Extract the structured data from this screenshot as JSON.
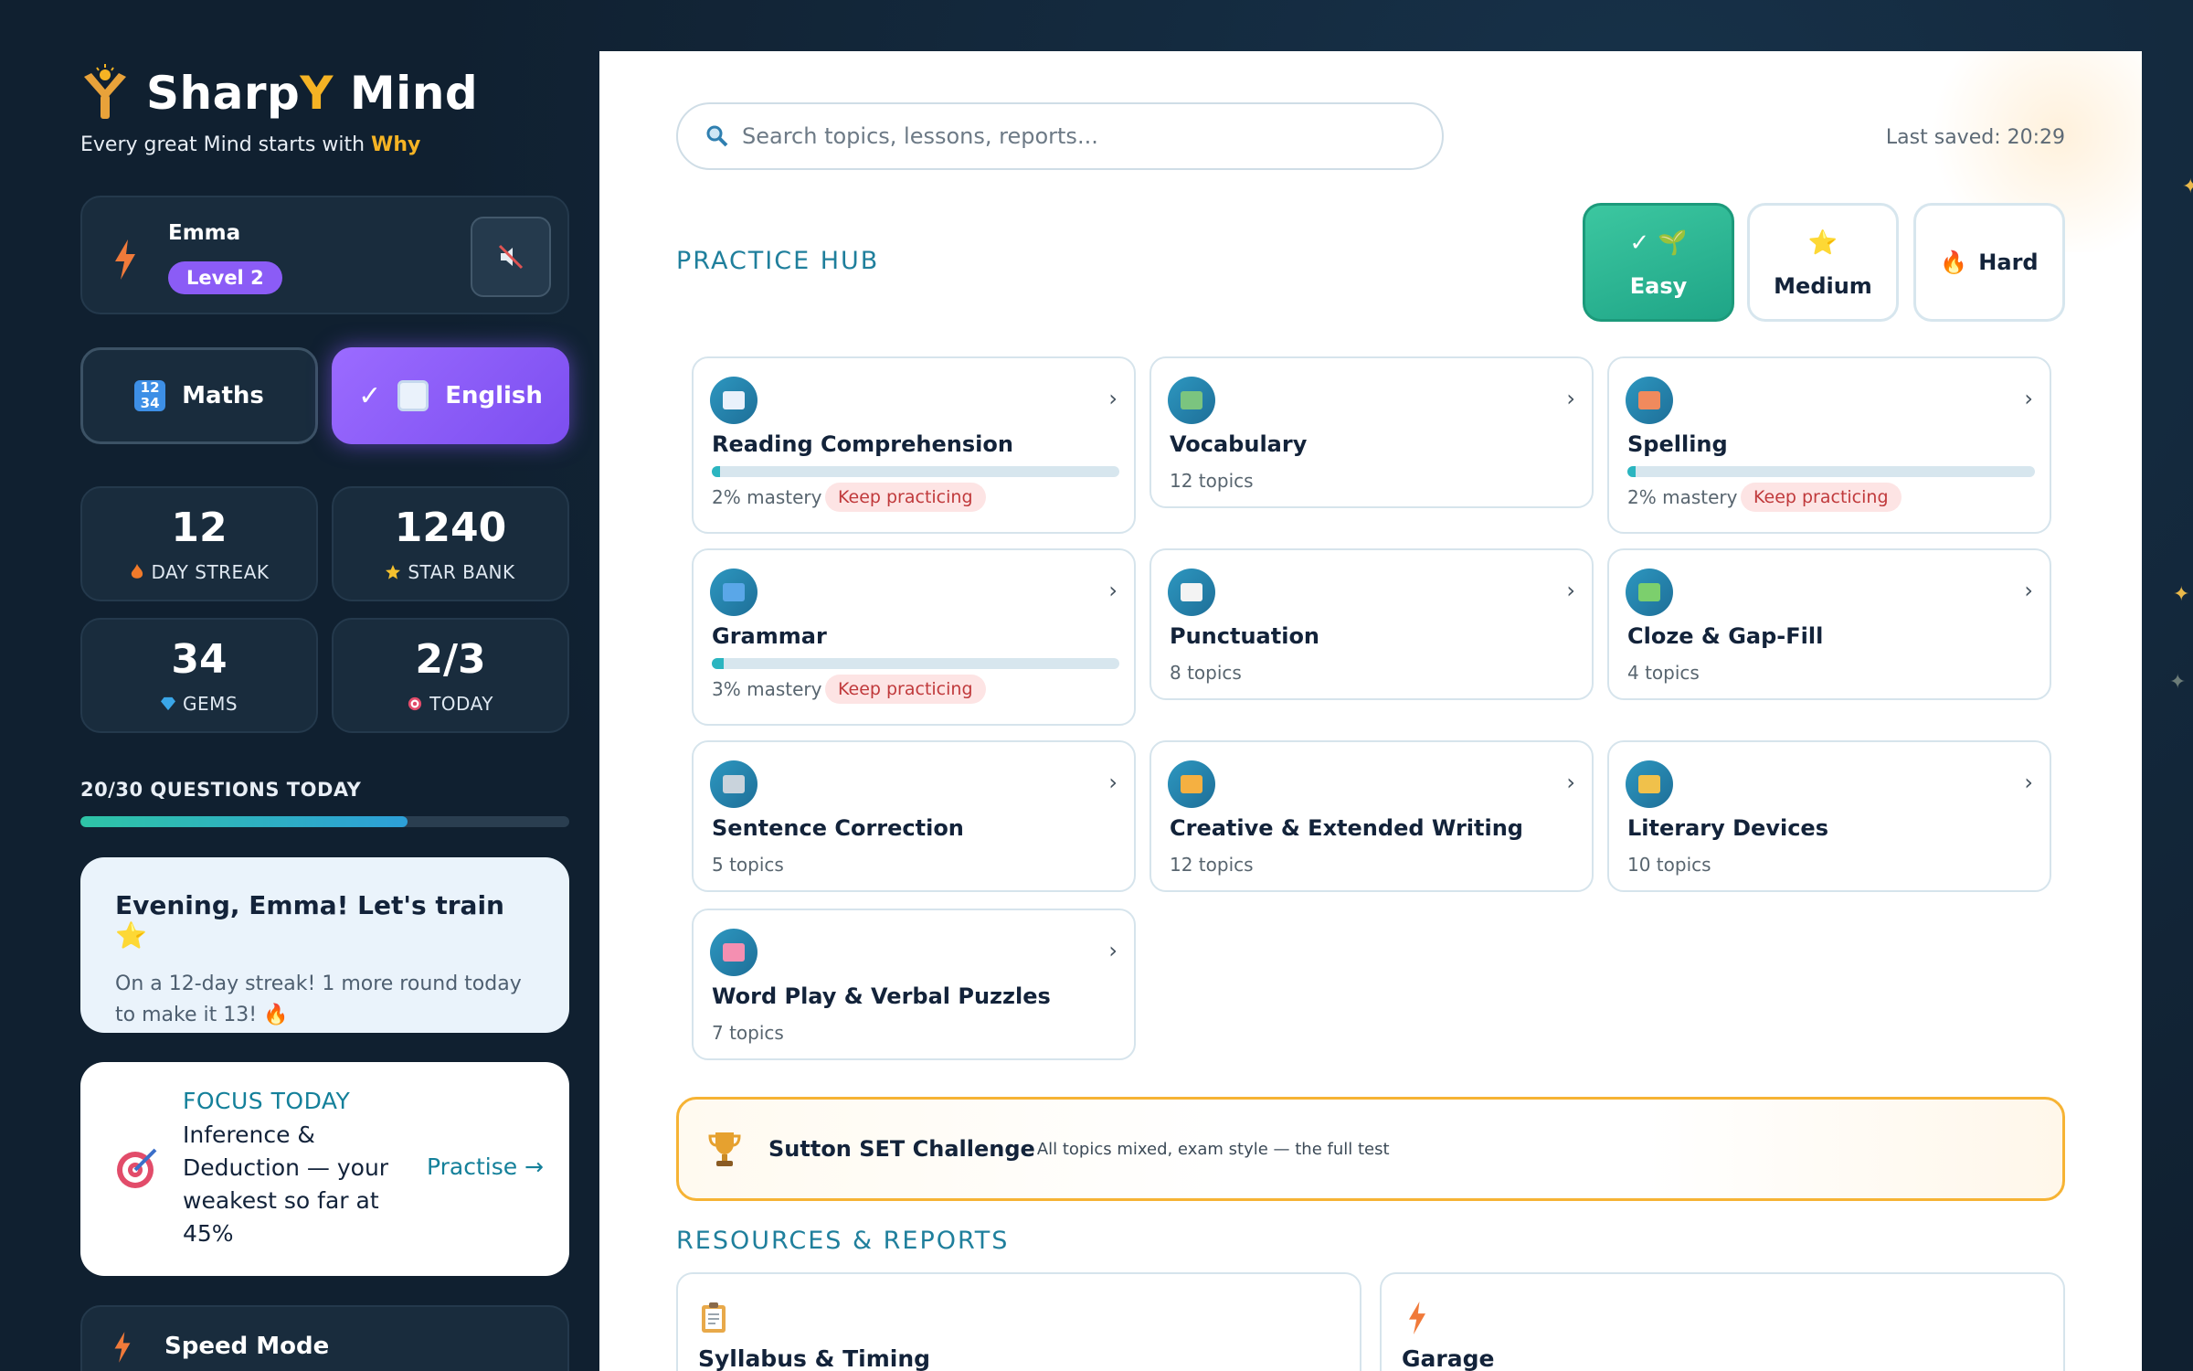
{
  "brand": {
    "name_a": "Sharp",
    "name_y": "Y",
    "name_b": " Mind",
    "tagline": "Every great Mind starts with ",
    "tagline_why": "Why"
  },
  "user": {
    "name": "Emma",
    "level": "Level 2"
  },
  "subjects": [
    {
      "label": "Maths",
      "selected": false
    },
    {
      "label": "English",
      "selected": true,
      "check": "✓"
    }
  ],
  "stats": [
    {
      "value": "12",
      "label": "DAY STREAK",
      "icon": "fire-icon"
    },
    {
      "value": "1240",
      "label": "STAR BANK",
      "icon": "star-icon"
    },
    {
      "value": "34",
      "label": "GEMS",
      "icon": "gem-icon"
    },
    {
      "value": "2/3",
      "label": "TODAY",
      "icon": "target-icon"
    }
  ],
  "questions": {
    "label": "20/30 QUESTIONS TODAY",
    "progress": 0.67
  },
  "greeting": {
    "title": "Evening, Emma! Let's train ⭐",
    "text": "On a 12-day streak! 1 more round today to make it 13! 🔥"
  },
  "focus": {
    "title": "FOCUS TODAY",
    "desc": "Inference & Deduction — your weakest so far at 45%",
    "action": "Practise →"
  },
  "speed": {
    "label": "Speed Mode"
  },
  "search": {
    "placeholder": "Search topics, lessons, reports..."
  },
  "last_saved": "Last saved: 20:29",
  "hub": {
    "title": "PRACTICE HUB",
    "difficulty": [
      {
        "label": "Easy",
        "emoji": "✓ 🌱",
        "selected": true
      },
      {
        "label": "Medium",
        "emoji": "⭐",
        "selected": false
      },
      {
        "label": "Hard",
        "emoji": "🔥",
        "selected": false
      }
    ],
    "topics": [
      {
        "name": "Reading Comprehension",
        "mastery": "2% mastery",
        "status": "Keep practicing",
        "progress": 0.02,
        "icon": "book-icon",
        "color": "#e9f1fb"
      },
      {
        "name": "Vocabulary",
        "count": "12 topics",
        "icon": "books-icon",
        "color": "#7bc47f"
      },
      {
        "name": "Spelling",
        "mastery": "2% mastery",
        "status": "Keep practicing",
        "progress": 0.02,
        "icon": "pencil-icon",
        "color": "#f08a5d"
      },
      {
        "name": "Grammar",
        "mastery": "3% mastery",
        "status": "Keep practicing",
        "progress": 0.03,
        "icon": "abc-icon",
        "color": "#5aa7e8"
      },
      {
        "name": "Punctuation",
        "count": "8 topics",
        "icon": "memo-icon",
        "color": "#f3f3f3"
      },
      {
        "name": "Cloze & Gap-Fill",
        "count": "4 topics",
        "icon": "puzzle-icon",
        "color": "#7ccf6d"
      },
      {
        "name": "Sentence Correction",
        "count": "5 topics",
        "icon": "wrench-icon",
        "color": "#c9d3dc"
      },
      {
        "name": "Creative & Extended Writing",
        "count": "12 topics",
        "icon": "writing-hand-icon",
        "color": "#f5b041"
      },
      {
        "name": "Literary Devices",
        "count": "10 topics",
        "icon": "theatre-icon",
        "color": "#f0c14b"
      },
      {
        "name": "Word Play & Verbal Puzzles",
        "count": "7 topics",
        "icon": "brain-icon",
        "color": "#f48fb1"
      }
    ]
  },
  "sutton": {
    "title": "Sutton SET Challenge",
    "desc": "All topics mixed, exam style — the full test"
  },
  "resources": {
    "title": "RESOURCES & REPORTS",
    "items": [
      {
        "label": "Syllabus & Timing",
        "icon": "clipboard-icon"
      },
      {
        "label": "Garage",
        "icon": "bolt-icon"
      }
    ]
  },
  "colors": {
    "accent_purple": "#8b5cf6",
    "teal": "#1f7f9c",
    "gold": "#f5b324",
    "easy_green": "#2bb592"
  }
}
